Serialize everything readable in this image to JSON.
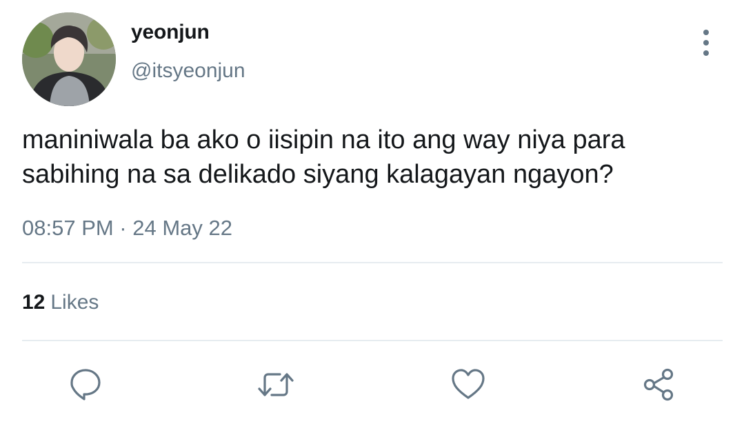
{
  "user": {
    "display_name": "yeonjun",
    "handle": "@itsyeonjun"
  },
  "tweet": {
    "text": "maniniwala ba ako o iisipin na ito ang way niya para sabihing na sa delikado siyang kalagayan ngayon?",
    "timestamp": "08:57 PM · 24 May 22"
  },
  "stats": {
    "likes_count": "12",
    "likes_label": "Likes"
  },
  "actions": {
    "reply_icon": "speech-bubble-icon",
    "retweet_icon": "retweet-arrows-icon",
    "like_icon": "heart-icon",
    "share_icon": "share-nodes-icon"
  },
  "colors": {
    "primary_text": "#14171a",
    "secondary_text": "#657786",
    "divider": "#e6ecf0",
    "background": "#ffffff"
  }
}
